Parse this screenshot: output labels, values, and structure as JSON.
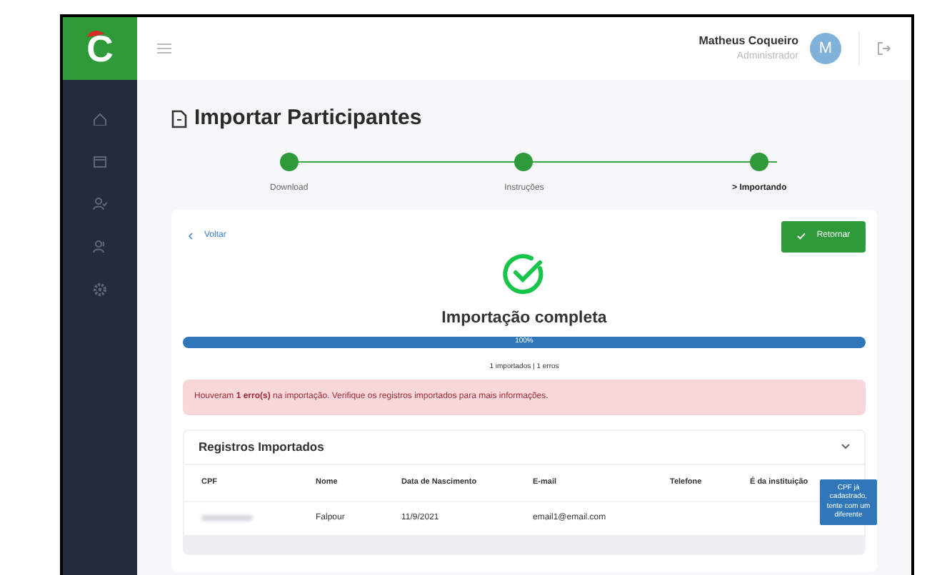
{
  "logo": {
    "letter": "C"
  },
  "sidebar": {
    "items": [
      {
        "selected": false
      },
      {
        "selected": false
      },
      {
        "selected": false
      },
      {
        "selected": false
      },
      {
        "selected": false
      }
    ]
  },
  "header": {
    "user_name": "Matheus Coqueiro",
    "user_role": "Administrador",
    "avatar": "M"
  },
  "page": {
    "title": "Importar Participantes"
  },
  "steps": [
    {
      "label": "Download",
      "current": false
    },
    {
      "label": "Instruções",
      "current": false
    },
    {
      "label": "> Importando",
      "current": true
    }
  ],
  "card": {
    "back": "Voltar",
    "action": "Retornar",
    "status": "Importação completa",
    "progress": {
      "level": 1,
      "label": "100%"
    },
    "summary": "1 importados | 1 erros",
    "alert": "Houveram **1 erro(s)** na importação. Verifique os registros importados para mais informações."
  },
  "records": {
    "title": "Registros Importados",
    "expanded": true,
    "columns": [
      "CPF",
      "Nome",
      "Data de Nascimento",
      "E-mail",
      "Telefone",
      "É da instituição"
    ],
    "rows": [
      {
        "cells": [
          "",
          "Falpour",
          "11/9/2021",
          "email1@email.com",
          "",
          ""
        ],
        "redacted_cpf": true
      }
    ],
    "tooltip": "CPF já cadastrado, tente com um diferente"
  }
}
